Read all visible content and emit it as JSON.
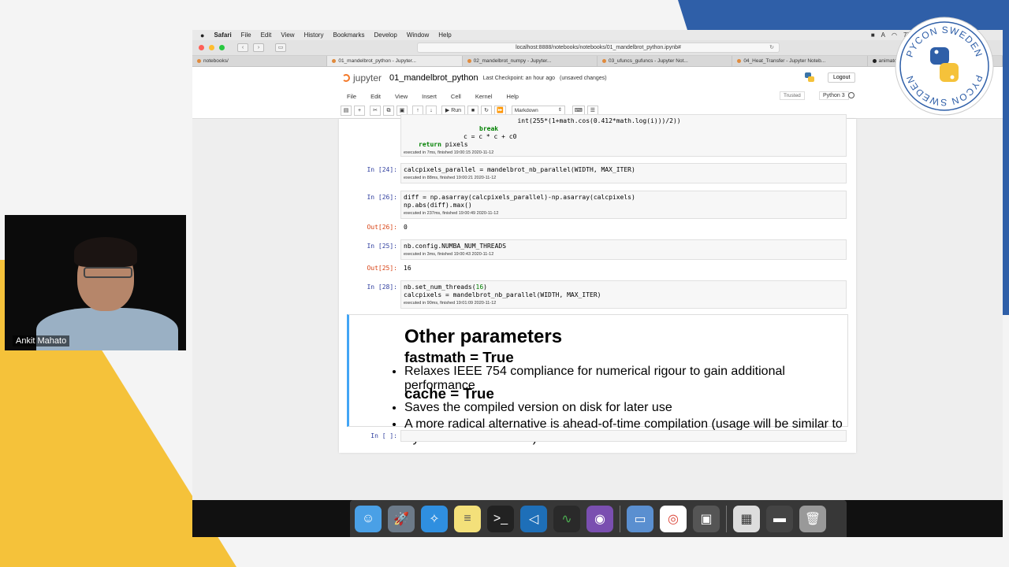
{
  "mac_menu": {
    "apple": "",
    "app": "Safari",
    "items": [
      "File",
      "Edit",
      "View",
      "History",
      "Bookmarks",
      "Develop",
      "Window",
      "Help"
    ],
    "battery": "77%"
  },
  "browser": {
    "url": "localhost:8888/notebooks/notebooks/01_mandelbrot_python.ipynb#",
    "tabs": [
      "notebooks/",
      "01_mandelbrot_python - Jupyter...",
      "02_mandelbrot_numpy - Jupyter...",
      "03_ufuncs_gufuncs - Jupyter Not...",
      "04_Heat_Transfer - Jupyter Noteb...",
      "animator/blurhash-numba: Fastes..."
    ]
  },
  "jupyter": {
    "logo_text": "jupyter",
    "notebook_name": "01_mandelbrot_python",
    "checkpoint": "Last Checkpoint: an hour ago",
    "unsaved": "(unsaved changes)",
    "logout": "Logout",
    "menu": [
      "File",
      "Edit",
      "View",
      "Insert",
      "Cell",
      "Kernel",
      "Help"
    ],
    "trusted": "Trusted",
    "kernel": "Python 3",
    "run_label": "Run",
    "cell_type": "Markdown"
  },
  "cells": {
    "c0": {
      "line1": "                              int(255*(1+math.cos(0.412*math.log(i)))/2))",
      "line2_kw": "break",
      "line3": "c = c * c + c0",
      "line4_kw": "return",
      "line4": " pixels",
      "exec": "executed in 7ms, finished 19:00:15 2020-11-12"
    },
    "c24": {
      "prompt": "In [24]:",
      "code": "calcpixels_parallel = mandelbrot_nb_parallel(WIDTH, MAX_ITER)",
      "exec": "executed in 88ms, finished 19:00:21 2020-11-12"
    },
    "c26": {
      "prompt": "In [26]:",
      "code1": "diff = np.asarray(calcpixels_parallel)-np.asarray(calcpixels)",
      "code2": "np.abs(diff).max()",
      "exec": "executed in 237ms, finished 19:00:49 2020-11-12",
      "out_prompt": "Out[26]:",
      "out": "0"
    },
    "c25": {
      "prompt": "In [25]:",
      "code": "nb.config.NUMBA_NUM_THREADS",
      "exec": "executed in 3ms, finished 19:00:43 2020-11-12",
      "out_prompt": "Out[25]:",
      "out": "16"
    },
    "c28": {
      "prompt": "In [28]:",
      "code1a": "nb.set_num_threads(",
      "code1b": "16",
      "code1c": ")",
      "code2": "calcpixels = mandelbrot_nb_parallel(WIDTH, MAX_ITER)",
      "exec": "executed in 90ms, finished 19:01:09 2020-11-12"
    },
    "markdown": {
      "h_main": "Other parameters",
      "h_fastmath": "fastmath = True",
      "fastmath_items": [
        "Relaxes IEEE 754 compliance for numerical rigour to gain additional performance"
      ],
      "h_cache": "cache = True",
      "cache_items": [
        "Saves the compiled version on disk for later use",
        "A more radical alternative is ahead-of-time compilation (usage will be similar to Python to C translators)"
      ]
    },
    "empty": {
      "prompt": "In [ ]:"
    }
  },
  "webcam": {
    "name": "Ankit Mahato"
  },
  "badge": {
    "text_top": "PYCON SWEDEN",
    "text_bottom": "PYCON SWEDEN"
  },
  "colors": {
    "accent_yellow": "#f5c23a",
    "accent_blue": "#2f5fa8",
    "md_border": "#42a5f5"
  }
}
